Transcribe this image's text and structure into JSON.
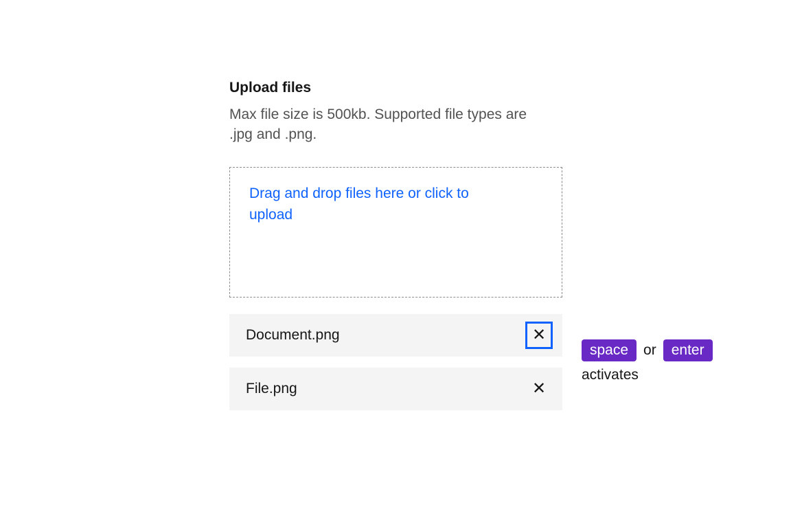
{
  "uploader": {
    "title": "Upload files",
    "description": "Max file size is 500kb. Supported file types are .jpg and .png.",
    "dropzone_text": "Drag and drop files here or click to upload",
    "files": [
      {
        "name": "Document.png",
        "focused": true
      },
      {
        "name": "File.png",
        "focused": false
      }
    ]
  },
  "hint": {
    "key1": "space",
    "or": "or",
    "key2": "enter",
    "verb": "activates"
  },
  "colors": {
    "accent_blue": "#0f62fe",
    "key_purple": "#6929c4",
    "text_primary": "#161616",
    "text_secondary": "#525252",
    "row_bg": "#f4f4f4",
    "dash_border": "#8d8d8d"
  }
}
